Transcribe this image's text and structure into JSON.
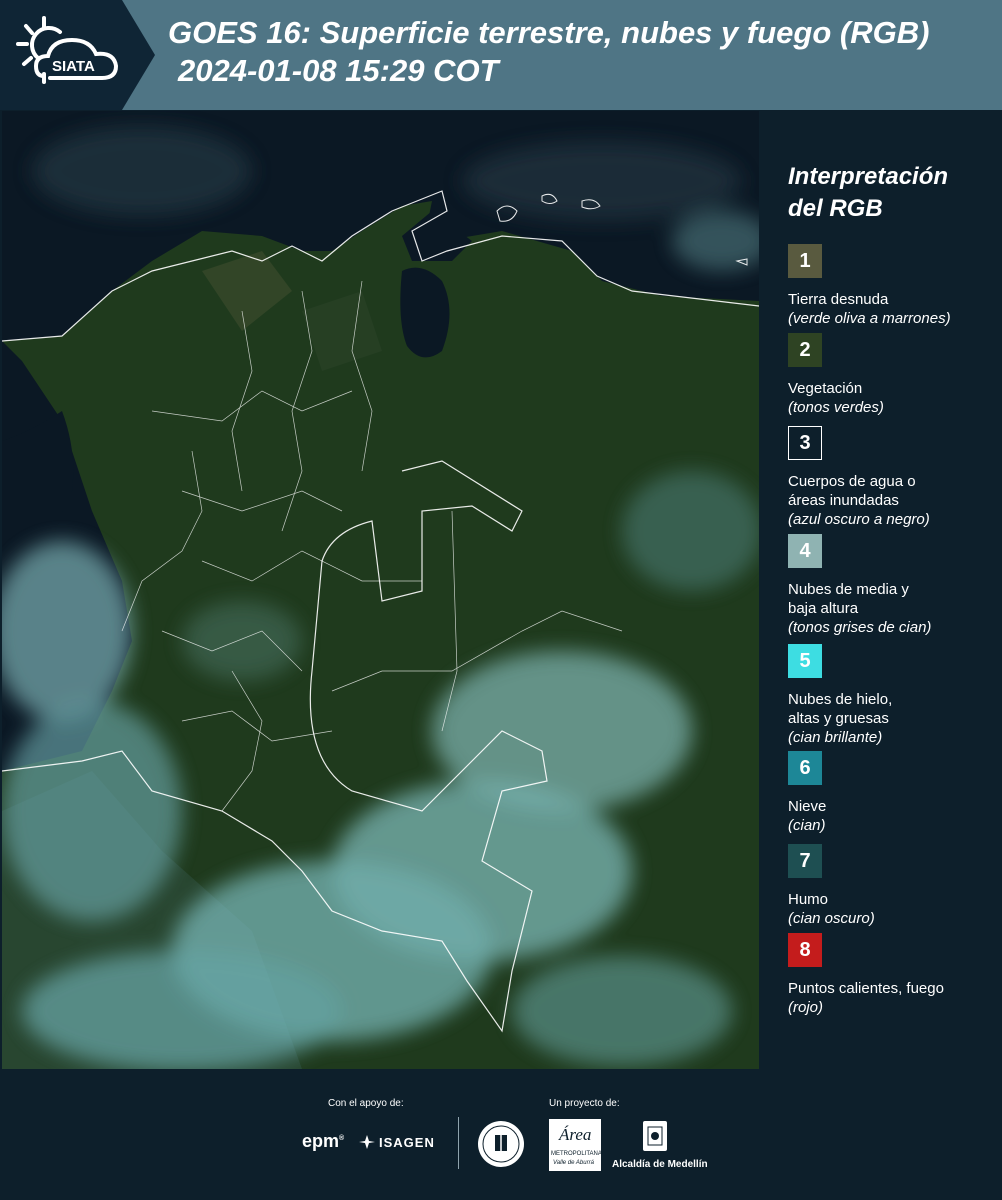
{
  "header": {
    "logo_text": "SIATA",
    "title_line1": "GOES 16: Superficie terrestre, nubes y fuego (RGB)",
    "title_line2": "2024-01-08 15:29 COT"
  },
  "legend": {
    "title_line1": "Interpretación",
    "title_line2": "del RGB",
    "items": [
      {
        "number": "1",
        "color": "#595a3f",
        "border": "#595a3f",
        "label_lines": [
          "Tierra desnuda"
        ],
        "sub": "(verde oliva a marrones)"
      },
      {
        "number": "2",
        "color": "#2e4323",
        "border": "#2e4323",
        "label_lines": [
          "Vegetación"
        ],
        "sub": "(tonos verdes)"
      },
      {
        "number": "3",
        "color": "#0d1f2b",
        "border": "#ffffff",
        "label_lines": [
          "Cuerpos de agua o",
          "áreas inundadas"
        ],
        "sub": "(azul oscuro a negro)"
      },
      {
        "number": "4",
        "color": "#8fb3b2",
        "border": "#8fb3b2",
        "label_lines": [
          "Nubes de media y",
          "baja altura"
        ],
        "sub": "(tonos grises de cian)"
      },
      {
        "number": "5",
        "color": "#3ddde2",
        "border": "#3ddde2",
        "label_lines": [
          "Nubes de hielo,",
          "altas y gruesas"
        ],
        "sub": "(cian brillante)"
      },
      {
        "number": "6",
        "color": "#1d8797",
        "border": "#1d8797",
        "label_lines": [
          "Nieve"
        ],
        "sub": "(cian)"
      },
      {
        "number": "7",
        "color": "#1e4f52",
        "border": "#1e4f52",
        "label_lines": [
          "Humo"
        ],
        "sub": "(cian oscuro)"
      },
      {
        "number": "8",
        "color": "#c41c1c",
        "border": "#c41c1c",
        "label_lines": [
          "Puntos calientes, fuego"
        ],
        "sub": "(rojo)"
      }
    ]
  },
  "footer": {
    "support_label": "Con el apoyo de:",
    "project_label": "Un proyecto de:",
    "epm": "epm",
    "isagen": "ISAGEN",
    "area_name": "Área",
    "area_sub1": "METROPOLITANA",
    "area_sub2": "Valle de Aburrá",
    "alcaldia": "Alcaldía de Medellín"
  },
  "colors": {
    "header_bg": "#4f7585",
    "header_dark": "#0f2535",
    "page_bg": "#0d1f2b",
    "vegetation": "#1f3a1d",
    "ocean": "#0b1824",
    "cloud": "#7fc2c4"
  }
}
